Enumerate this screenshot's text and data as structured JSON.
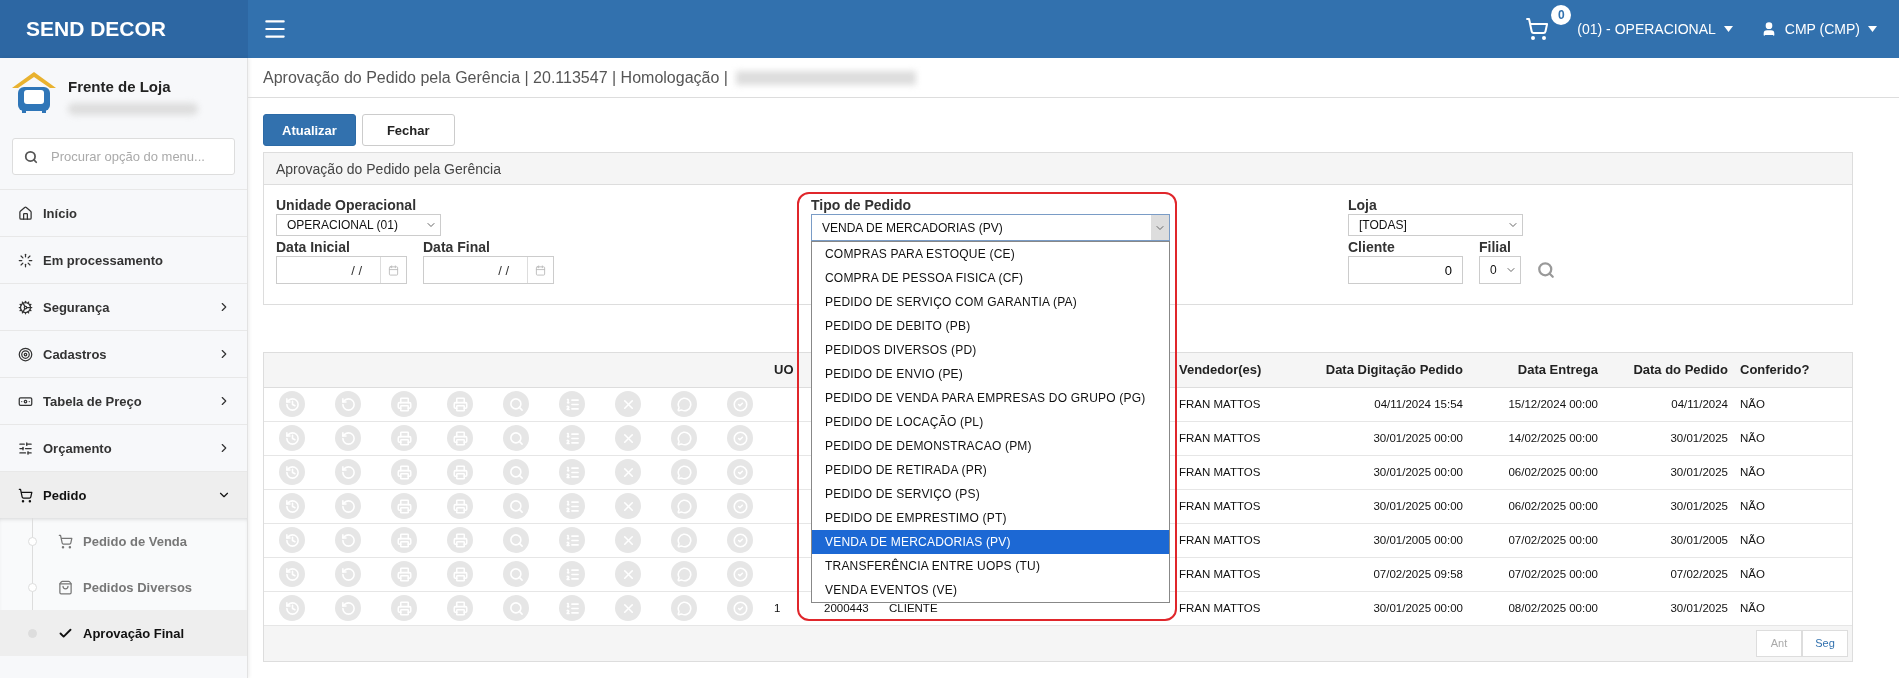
{
  "topbar": {
    "brand": "SEND DECOR",
    "cart_count": "0",
    "unit_menu": "(01) - OPERACIONAL",
    "user_menu": "CMP (CMP)"
  },
  "sidebar": {
    "module": "Frente de Loja",
    "search": {
      "placeholder": "Procurar opção do menu..."
    },
    "items": [
      {
        "label": "Início",
        "kind": "link",
        "selected": false
      },
      {
        "label": "Em processamento",
        "kind": "link",
        "selected": false
      },
      {
        "label": "Segurança",
        "kind": "group",
        "selected": false,
        "expanded": false
      },
      {
        "label": "Cadastros",
        "kind": "group",
        "selected": false,
        "expanded": false
      },
      {
        "label": "Tabela de Preço",
        "kind": "group",
        "selected": false,
        "expanded": false
      },
      {
        "label": "Orçamento",
        "kind": "group",
        "selected": false,
        "expanded": false
      },
      {
        "label": "Pedido",
        "kind": "group",
        "selected": true,
        "expanded": true,
        "children": [
          {
            "label": "Pedido de Venda",
            "selected": false
          },
          {
            "label": "Pedidos Diversos",
            "selected": false
          },
          {
            "label": "Aprovação Final",
            "selected": true
          }
        ]
      }
    ]
  },
  "page": {
    "title": "Aprovação do Pedido pela Gerência | 20.113547 | Homologação |",
    "buttons": [
      {
        "label": "Atualizar",
        "kind": "primary"
      },
      {
        "label": "Fechar",
        "kind": "default"
      }
    ]
  },
  "filters": {
    "title": "Aprovação do Pedido pela Gerência",
    "unit": {
      "label": "Unidade Operacional",
      "value": "OPERACIONAL (01)"
    },
    "start_date": {
      "label": "Data Inicial",
      "value": "/ /"
    },
    "end_date": {
      "label": "Data Final",
      "value": "/ /"
    },
    "order_type": {
      "label": "Tipo de Pedido",
      "value": "VENDA DE MERCADORIAS (PV)",
      "expanded": true,
      "highlighted": true,
      "options": [
        {
          "label": "COMPRAS PARA ESTOQUE (CE)",
          "selected": false
        },
        {
          "label": "COMPRA DE PESSOA FISICA (CF)",
          "selected": false
        },
        {
          "label": "PEDIDO DE SERVIÇO COM GARANTIA (PA)",
          "selected": false
        },
        {
          "label": "PEDIDO DE DEBITO (PB)",
          "selected": false
        },
        {
          "label": "PEDIDOS DIVERSOS (PD)",
          "selected": false
        },
        {
          "label": "PEDIDO DE ENVIO (PE)",
          "selected": false
        },
        {
          "label": "PEDIDO DE VENDA PARA EMPRESAS DO GRUPO (PG)",
          "selected": false
        },
        {
          "label": "PEDIDO DE LOCAÇÃO (PL)",
          "selected": false
        },
        {
          "label": "PEDIDO DE DEMONSTRACAO (PM)",
          "selected": false
        },
        {
          "label": "PEDIDO DE RETIRADA (PR)",
          "selected": false
        },
        {
          "label": "PEDIDO DE SERVIÇO (PS)",
          "selected": false
        },
        {
          "label": "PEDIDO DE EMPRESTIMO (PT)",
          "selected": false
        },
        {
          "label": "VENDA DE MERCADORIAS (PV)",
          "selected": true
        },
        {
          "label": "TRANSFERÊNCIA ENTRE UOPS (TU)",
          "selected": false
        },
        {
          "label": "VENDA EVENTOS (VE)",
          "selected": false
        }
      ]
    },
    "store": {
      "label": "Loja",
      "value": "[TODAS]"
    },
    "client": {
      "label": "Cliente",
      "value": "0"
    },
    "branch": {
      "label": "Filial",
      "value": "0"
    }
  },
  "table": {
    "headers": {
      "uo": "UO",
      "seller": "Vendedor(es)",
      "typed_date": "Data Digitação Pedido",
      "delivery_date": "Data Entrega",
      "order_date": "Data do Pedido",
      "conferido": "Conferido?"
    },
    "rows": [
      {
        "seller": "FRAN MATTOS",
        "typed_date": "04/11/2024 15:54",
        "delivery_date": "15/12/2024 00:00",
        "order_date": "04/11/2024",
        "conferido": "NÃO"
      },
      {
        "seller": "FRAN MATTOS",
        "typed_date": "30/01/2025 00:00",
        "delivery_date": "14/02/2025 00:00",
        "order_date": "30/01/2025",
        "conferido": "NÃO"
      },
      {
        "seller": "FRAN MATTOS",
        "typed_date": "30/01/2025 00:00",
        "delivery_date": "06/02/2025 00:00",
        "order_date": "30/01/2025",
        "conferido": "NÃO"
      },
      {
        "seller": "FRAN MATTOS",
        "typed_date": "30/01/2025 00:00",
        "delivery_date": "06/02/2025 00:00",
        "order_date": "30/01/2025",
        "conferido": "NÃO"
      },
      {
        "seller": "FRAN MATTOS",
        "typed_date": "30/01/2005 00:00",
        "delivery_date": "07/02/2025 00:00",
        "order_date": "30/01/2005",
        "conferido": "NÃO"
      },
      {
        "seller": "FRAN MATTOS",
        "typed_date": "07/02/2025 09:58",
        "delivery_date": "07/02/2025 00:00",
        "order_date": "07/02/2025",
        "conferido": "NÃO"
      },
      {
        "uo": "1",
        "column_2": "2000443",
        "column_3": "CLIENTE",
        "seller": "FRAN MATTOS",
        "typed_date": "30/01/2025 00:00",
        "delivery_date": "08/02/2025 00:00",
        "order_date": "30/01/2025",
        "conferido": "NÃO"
      }
    ],
    "pagination": {
      "prev": {
        "label": "Ant",
        "disabled": true
      },
      "next": {
        "label": "Seg",
        "disabled": false
      }
    }
  }
}
